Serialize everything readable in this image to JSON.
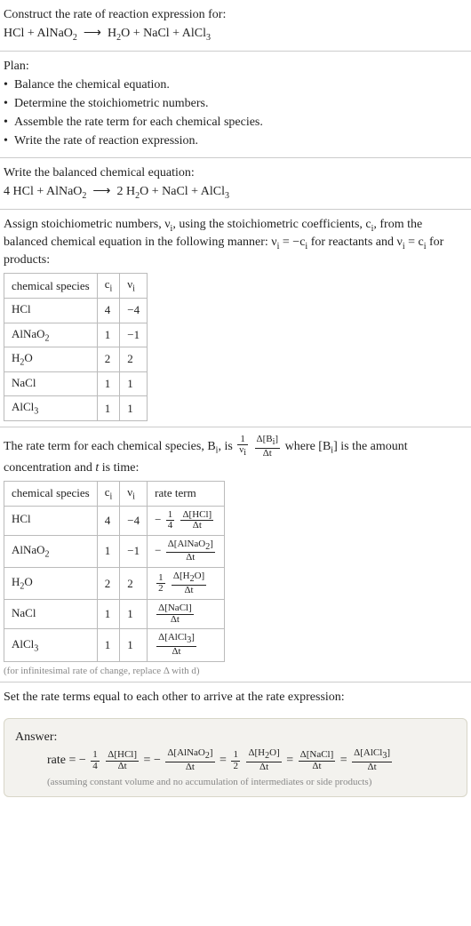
{
  "prompt": {
    "title": "Construct the rate of reaction expression for:",
    "reaction_lhs": "HCl + AlNaO",
    "reaction_lhs_sub": "2",
    "arrow": "⟶",
    "reaction_rhs_a": "H",
    "reaction_rhs_a_sub": "2",
    "reaction_rhs_b": "O + NaCl + AlCl",
    "reaction_rhs_b_sub": "3"
  },
  "plan": {
    "title": "Plan:",
    "items": [
      "Balance the chemical equation.",
      "Determine the stoichiometric numbers.",
      "Assemble the rate term for each chemical species.",
      "Write the rate of reaction expression."
    ]
  },
  "balanced": {
    "title": "Write the balanced chemical equation:",
    "lhs_a": "4 HCl + AlNaO",
    "lhs_a_sub": "2",
    "arrow": "⟶",
    "rhs_a": "2 H",
    "rhs_a_sub": "2",
    "rhs_b": "O + NaCl + AlCl",
    "rhs_b_sub": "3"
  },
  "stoich_text": {
    "intro_a": "Assign stoichiometric numbers, ν",
    "intro_a_sub": "i",
    "intro_b": ", using the stoichiometric coefficients, c",
    "intro_b_sub": "i",
    "intro_c": ", from the balanced chemical equation in the following manner: ν",
    "intro_c_sub": "i",
    "intro_d": " = −c",
    "intro_d_sub": "i",
    "intro_e": " for reactants and ν",
    "intro_e_sub": "i",
    "intro_f": " = c",
    "intro_f_sub": "i",
    "intro_g": " for products:"
  },
  "table1": {
    "headers": {
      "species": "chemical species",
      "c": "c",
      "csub": "i",
      "v": "ν",
      "vsub": "i"
    },
    "rows": [
      {
        "sp_a": "HCl",
        "sp_sub": "",
        "c": "4",
        "v": "−4"
      },
      {
        "sp_a": "AlNaO",
        "sp_sub": "2",
        "c": "1",
        "v": "−1"
      },
      {
        "sp_a": "H",
        "sp_sub": "2",
        "sp_b": "O",
        "c": "2",
        "v": "2"
      },
      {
        "sp_a": "NaCl",
        "sp_sub": "",
        "c": "1",
        "v": "1"
      },
      {
        "sp_a": "AlCl",
        "sp_sub": "3",
        "c": "1",
        "v": "1"
      }
    ]
  },
  "rateterm_text": {
    "a": "The rate term for each chemical species, B",
    "a_sub": "i",
    "b": ", is ",
    "frac1_num": "1",
    "frac1_den_a": "ν",
    "frac1_den_sub": "i",
    "frac2_num_a": "Δ[B",
    "frac2_num_sub": "i",
    "frac2_num_b": "]",
    "frac2_den": "Δt",
    "c": " where [B",
    "c_sub": "i",
    "d": "] is the amount concentration and ",
    "e_it": "t",
    "f": " is time:"
  },
  "table2": {
    "headers": {
      "species": "chemical species",
      "c": "c",
      "csub": "i",
      "v": "ν",
      "vsub": "i",
      "rate": "rate term"
    },
    "rows": [
      {
        "sp_a": "HCl",
        "sp_sub": "",
        "c": "4",
        "v": "−4",
        "neg": "−",
        "coef_num": "1",
        "coef_den": "4",
        "br_a": "Δ[HCl]",
        "br_den": "Δt"
      },
      {
        "sp_a": "AlNaO",
        "sp_sub": "2",
        "c": "1",
        "v": "−1",
        "neg": "−",
        "coef_num": "",
        "coef_den": "",
        "br_a": "Δ[AlNaO",
        "br_sub": "2",
        "br_b": "]",
        "br_den": "Δt"
      },
      {
        "sp_a": "H",
        "sp_sub": "2",
        "sp_b": "O",
        "c": "2",
        "v": "2",
        "neg": "",
        "coef_num": "1",
        "coef_den": "2",
        "br_a": "Δ[H",
        "br_sub": "2",
        "br_b": "O]",
        "br_den": "Δt"
      },
      {
        "sp_a": "NaCl",
        "sp_sub": "",
        "c": "1",
        "v": "1",
        "neg": "",
        "coef_num": "",
        "coef_den": "",
        "br_a": "Δ[NaCl]",
        "br_den": "Δt"
      },
      {
        "sp_a": "AlCl",
        "sp_sub": "3",
        "c": "1",
        "v": "1",
        "neg": "",
        "coef_num": "",
        "coef_den": "",
        "br_a": "Δ[AlCl",
        "br_sub": "3",
        "br_b": "]",
        "br_den": "Δt"
      }
    ],
    "footnote": "(for infinitesimal rate of change, replace Δ with d)"
  },
  "final_text": "Set the rate terms equal to each other to arrive at the rate expression:",
  "answer": {
    "title": "Answer:",
    "lead": "rate = ",
    "t1": {
      "neg": "−",
      "cnum": "1",
      "cden": "4",
      "num": "Δ[HCl]",
      "den": "Δt"
    },
    "eq": " = ",
    "t2": {
      "neg": "−",
      "num_a": "Δ[AlNaO",
      "num_sub": "2",
      "num_b": "]",
      "den": "Δt"
    },
    "t3": {
      "cnum": "1",
      "cden": "2",
      "num_a": "Δ[H",
      "num_sub": "2",
      "num_b": "O]",
      "den": "Δt"
    },
    "t4": {
      "num": "Δ[NaCl]",
      "den": "Δt"
    },
    "t5": {
      "num_a": "Δ[AlCl",
      "num_sub": "3",
      "num_b": "]",
      "den": "Δt"
    },
    "note": "(assuming constant volume and no accumulation of intermediates or side products)"
  },
  "chart_data": {
    "type": "table",
    "title": "Stoichiometric coefficients and rate terms",
    "columns": [
      "chemical species",
      "c_i",
      "ν_i",
      "rate term"
    ],
    "rows": [
      [
        "HCl",
        4,
        -4,
        "-(1/4) Δ[HCl]/Δt"
      ],
      [
        "AlNaO2",
        1,
        -1,
        "- Δ[AlNaO2]/Δt"
      ],
      [
        "H2O",
        2,
        2,
        "(1/2) Δ[H2O]/Δt"
      ],
      [
        "NaCl",
        1,
        1,
        "Δ[NaCl]/Δt"
      ],
      [
        "AlCl3",
        1,
        1,
        "Δ[AlCl3]/Δt"
      ]
    ],
    "balanced_equation": "4 HCl + AlNaO2 ⟶ 2 H2O + NaCl + AlCl3",
    "rate_expression": "rate = -(1/4) Δ[HCl]/Δt = - Δ[AlNaO2]/Δt = (1/2) Δ[H2O]/Δt = Δ[NaCl]/Δt = Δ[AlCl3]/Δt"
  }
}
